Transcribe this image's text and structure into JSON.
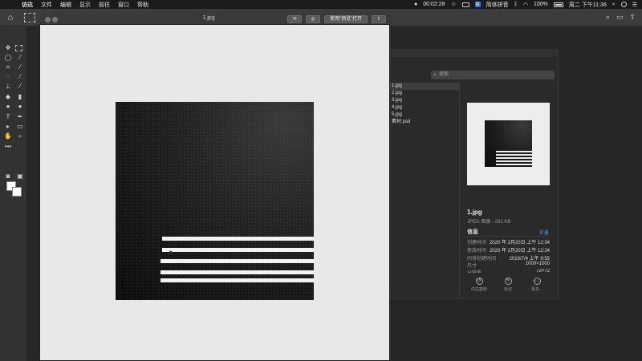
{
  "menubar": {
    "items": [
      "访达",
      "文件",
      "编辑",
      "显示",
      "前往",
      "窗口",
      "帮助"
    ],
    "timer": "00:02:28",
    "ime_label": "简体拼音",
    "battery": "100%",
    "datetime": "周二 下午11:36"
  },
  "document": {
    "title": "1.jpg",
    "open_with_label": "使用“预览”打开"
  },
  "finder": {
    "search_placeholder": "搜索",
    "files": [
      "1.jpg",
      "2.jpg",
      "3.jpg",
      "4.jpg",
      "5.jpg",
      "素材.psd"
    ],
    "selected_index": 0,
    "preview": {
      "name": "1.jpg",
      "type": "JPEG 图像 - 261 KB",
      "info_heading": "信息",
      "info_toggle": "折叠",
      "rows": [
        {
          "label": "创建时间",
          "value": "2020 年 2月20日 上午 12:34"
        },
        {
          "label": "修改时间",
          "value": "2020 年 2月20日 上午 12:34"
        },
        {
          "label": "内容创建时间",
          "value": "2016/7/4 上午 9:55"
        },
        {
          "label": "尺寸",
          "value": "1000×1000"
        },
        {
          "label": "分辨率",
          "value": "72×72"
        }
      ],
      "actions": [
        "向左旋转",
        "标记",
        "更多..."
      ]
    }
  },
  "colors": {
    "accent": "#4d8fe8",
    "toolbar_bg": "#323232",
    "canvas_bg": "#e8e8e8"
  }
}
